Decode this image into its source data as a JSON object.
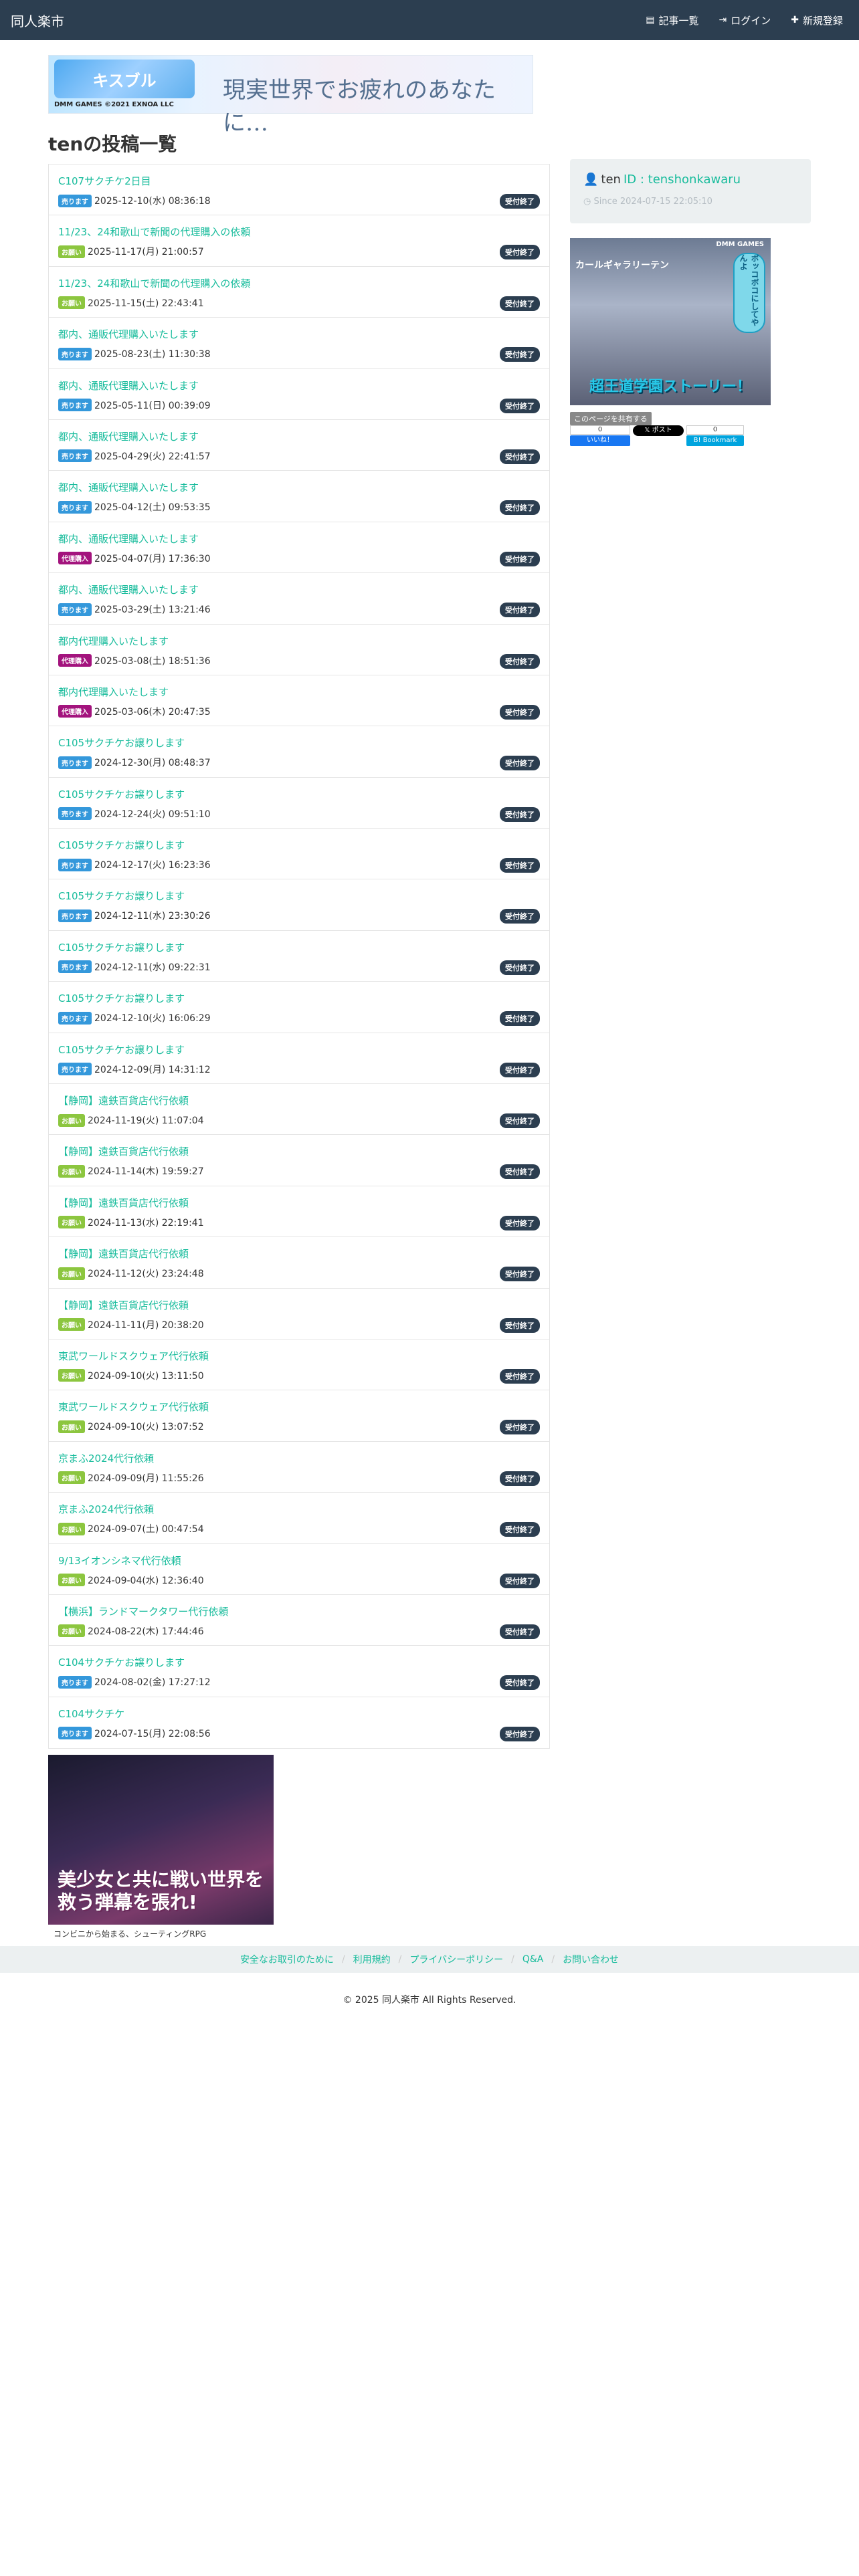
{
  "header": {
    "brand": "同人楽市",
    "nav": [
      {
        "label": "記事一覧",
        "icon": "list-icon"
      },
      {
        "label": "ログイン",
        "icon": "login-icon"
      },
      {
        "label": "新規登録",
        "icon": "plus-icon"
      }
    ]
  },
  "ad_top": {
    "logo_text": "キスブル",
    "maker": "DMM GAMES ©2021 EXNOA LLC",
    "slogan": "現実世界でお疲れのあなたに…"
  },
  "page_title": "tenの投稿一覧",
  "tag_colors": {
    "売ります": "#3498db",
    "お願い": "#8cc63f",
    "代理購入": "#a3137d"
  },
  "posts": [
    {
      "title": "C107サクチケ2日目",
      "tag": "売ります",
      "date": "2025-12-10(水) 08:36:18",
      "status": "受付終了"
    },
    {
      "title": "11/23、24和歌山で新聞の代理購入の依頼",
      "tag": "お願い",
      "date": "2025-11-17(月) 21:00:57",
      "status": "受付終了"
    },
    {
      "title": "11/23、24和歌山で新聞の代理購入の依頼",
      "tag": "お願い",
      "date": "2025-11-15(土) 22:43:41",
      "status": "受付終了"
    },
    {
      "title": "都内、通販代理購入いたします",
      "tag": "売ります",
      "date": "2025-08-23(土) 11:30:38",
      "status": "受付終了"
    },
    {
      "title": "都内、通販代理購入いたします",
      "tag": "売ります",
      "date": "2025-05-11(日) 00:39:09",
      "status": "受付終了"
    },
    {
      "title": "都内、通販代理購入いたします",
      "tag": "売ります",
      "date": "2025-04-29(火) 22:41:57",
      "status": "受付終了"
    },
    {
      "title": "都内、通販代理購入いたします",
      "tag": "売ります",
      "date": "2025-04-12(土) 09:53:35",
      "status": "受付終了"
    },
    {
      "title": "都内、通販代理購入いたします",
      "tag": "代理購入",
      "date": "2025-04-07(月) 17:36:30",
      "status": "受付終了"
    },
    {
      "title": "都内、通販代理購入いたします",
      "tag": "売ります",
      "date": "2025-03-29(土) 13:21:46",
      "status": "受付終了"
    },
    {
      "title": "都内代理購入いたします",
      "tag": "代理購入",
      "date": "2025-03-08(土) 18:51:36",
      "status": "受付終了"
    },
    {
      "title": "都内代理購入いたします",
      "tag": "代理購入",
      "date": "2025-03-06(木) 20:47:35",
      "status": "受付終了"
    },
    {
      "title": "C105サクチケお譲りします",
      "tag": "売ります",
      "date": "2024-12-30(月) 08:48:37",
      "status": "受付終了"
    },
    {
      "title": "C105サクチケお譲りします",
      "tag": "売ります",
      "date": "2024-12-24(火) 09:51:10",
      "status": "受付終了"
    },
    {
      "title": "C105サクチケお譲りします",
      "tag": "売ります",
      "date": "2024-12-17(火) 16:23:36",
      "status": "受付終了"
    },
    {
      "title": "C105サクチケお譲りします",
      "tag": "売ります",
      "date": "2024-12-11(水) 23:30:26",
      "status": "受付終了"
    },
    {
      "title": "C105サクチケお譲りします",
      "tag": "売ります",
      "date": "2024-12-11(水) 09:22:31",
      "status": "受付終了"
    },
    {
      "title": "C105サクチケお譲りします",
      "tag": "売ります",
      "date": "2024-12-10(火) 16:06:29",
      "status": "受付終了"
    },
    {
      "title": "C105サクチケお譲りします",
      "tag": "売ります",
      "date": "2024-12-09(月) 14:31:12",
      "status": "受付終了"
    },
    {
      "title": "【静岡】遠鉄百貨店代行依頼",
      "tag": "お願い",
      "date": "2024-11-19(火) 11:07:04",
      "status": "受付終了"
    },
    {
      "title": "【静岡】遠鉄百貨店代行依頼",
      "tag": "お願い",
      "date": "2024-11-14(木) 19:59:27",
      "status": "受付終了"
    },
    {
      "title": "【静岡】遠鉄百貨店代行依頼",
      "tag": "お願い",
      "date": "2024-11-13(水) 22:19:41",
      "status": "受付終了"
    },
    {
      "title": "【静岡】遠鉄百貨店代行依頼",
      "tag": "お願い",
      "date": "2024-11-12(火) 23:24:48",
      "status": "受付終了"
    },
    {
      "title": "【静岡】遠鉄百貨店代行依頼",
      "tag": "お願い",
      "date": "2024-11-11(月) 20:38:20",
      "status": "受付終了"
    },
    {
      "title": "東武ワールドスクウェア代行依頼",
      "tag": "お願い",
      "date": "2024-09-10(火) 13:11:50",
      "status": "受付終了"
    },
    {
      "title": "東武ワールドスクウェア代行依頼",
      "tag": "お願い",
      "date": "2024-09-10(火) 13:07:52",
      "status": "受付終了"
    },
    {
      "title": "京まふ2024代行依頼",
      "tag": "お願い",
      "date": "2024-09-09(月) 11:55:26",
      "status": "受付終了"
    },
    {
      "title": "京まふ2024代行依頼",
      "tag": "お願い",
      "date": "2024-09-07(土) 00:47:54",
      "status": "受付終了"
    },
    {
      "title": "9/13イオンシネマ代行依頼",
      "tag": "お願い",
      "date": "2024-09-04(水) 12:36:40",
      "status": "受付終了"
    },
    {
      "title": "【横浜】ランドマークタワー代行依頼",
      "tag": "お願い",
      "date": "2024-08-22(木) 17:44:46",
      "status": "受付終了"
    },
    {
      "title": "C104サクチケお譲りします",
      "tag": "売ります",
      "date": "2024-08-02(金) 17:27:12",
      "status": "受付終了"
    },
    {
      "title": "C104サクチケ",
      "tag": "売ります",
      "date": "2024-07-15(月) 22:08:56",
      "status": "受付終了"
    }
  ],
  "profile": {
    "name": "ten",
    "id_label": "ID : tenshonkawaru",
    "since": "Since 2024-07-15 22:05:10"
  },
  "ad_side": {
    "maker": "DMM GAMES",
    "site": "カールギャラリーテン",
    "bubble": "ボッコボコにしてやんよ",
    "title": "超王道学園ストーリー！"
  },
  "share": {
    "label": "このページを共有する",
    "fb_count": "0",
    "fb_label": "いいね！",
    "x_label": "ポスト",
    "hb_count": "0",
    "hb_label": "Bookmark"
  },
  "ad_bottom": {
    "title": "美少女と共に戦い世界を救う弾幕を張れ!",
    "caption": "コンビニから始まる、シューティングRPG"
  },
  "footer": {
    "links": [
      "安全なお取引のために",
      "利用規約",
      "プライバシーポリシー",
      "Q&A",
      "お問い合わせ"
    ],
    "copyright": "© 2025 同人楽市 All Rights Reserved."
  }
}
